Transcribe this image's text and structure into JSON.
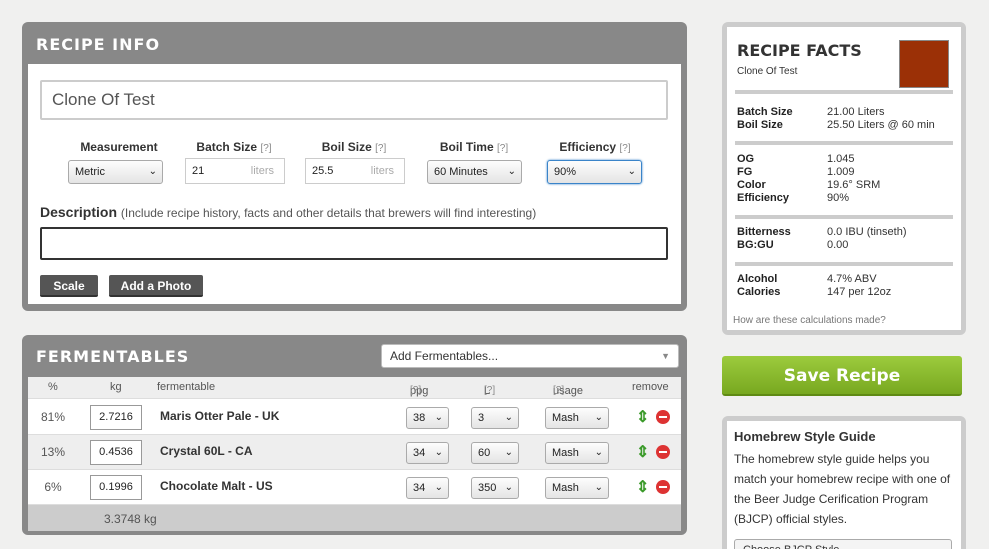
{
  "recipe_info": {
    "title": "RECIPE INFO",
    "name_value": "Clone Of Test",
    "measurement": {
      "label": "Measurement",
      "value": "Metric"
    },
    "batch_size": {
      "label": "Batch Size",
      "help": "[?]",
      "value": "21",
      "unit": "liters"
    },
    "boil_size": {
      "label": "Boil Size",
      "help": "[?]",
      "value": "25.5",
      "unit": "liters"
    },
    "boil_time": {
      "label": "Boil Time",
      "help": "[?]",
      "value": "60 Minutes"
    },
    "efficiency": {
      "label": "Efficiency",
      "help": "[?]",
      "value": "90%"
    },
    "description_label": "Description",
    "description_note": "(Include recipe history, facts and other details that brewers will find interesting)",
    "description_value": "",
    "scale_label": "Scale",
    "add_photo_label": "Add a Photo"
  },
  "recipe_facts": {
    "title": "RECIPE FACTS",
    "subtitle": "Clone Of Test",
    "swatch_color": "#9b3006",
    "rows": [
      {
        "k": "Batch Size",
        "v": "21.00 Liters"
      },
      {
        "k": "Boil Size",
        "v": "25.50 Liters @ 60 min"
      },
      {
        "k": "OG",
        "v": "1.045"
      },
      {
        "k": "FG",
        "v": "1.009"
      },
      {
        "k": "Color",
        "v": "19.6° SRM"
      },
      {
        "k": "Efficiency",
        "v": "90%"
      },
      {
        "k": "Bitterness",
        "v": "0.0 IBU (tinseth)"
      },
      {
        "k": "BG:GU",
        "v": "0.00"
      },
      {
        "k": "Alcohol",
        "v": "4.7% ABV"
      },
      {
        "k": "Calories",
        "v": "147 per 12oz"
      }
    ],
    "calc_link": "How are these calculations made?"
  },
  "save_label": "Save Recipe",
  "style_guide": {
    "title": "Homebrew Style Guide",
    "text": "The homebrew style guide helps you match your homebrew recipe with one of the Beer Judge Cerification Program (BJCP) official styles.",
    "select_value": "Choose BJCP Style"
  },
  "fermentables": {
    "title": "FERMENTABLES",
    "add_placeholder": "Add Fermentables...",
    "headers": {
      "pct": "%",
      "kg": "kg",
      "name": "fermentable",
      "ppg": "ppg",
      "ppg_help": "[?]",
      "l": "L",
      "l_help": "[?]",
      "usage": "usage",
      "usage_help": "[?]",
      "remove": "remove"
    },
    "rows": [
      {
        "pct": "81%",
        "kg": "2.7216",
        "name": "Maris Otter Pale - UK",
        "ppg": "38",
        "l": "3",
        "usage": "Mash"
      },
      {
        "pct": "13%",
        "kg": "0.4536",
        "name": "Crystal 60L - CA",
        "ppg": "34",
        "l": "60",
        "usage": "Mash"
      },
      {
        "pct": "6%",
        "kg": "0.1996",
        "name": "Chocolate Malt - US",
        "ppg": "34",
        "l": "350",
        "usage": "Mash"
      }
    ],
    "total": "3.3748 kg"
  }
}
